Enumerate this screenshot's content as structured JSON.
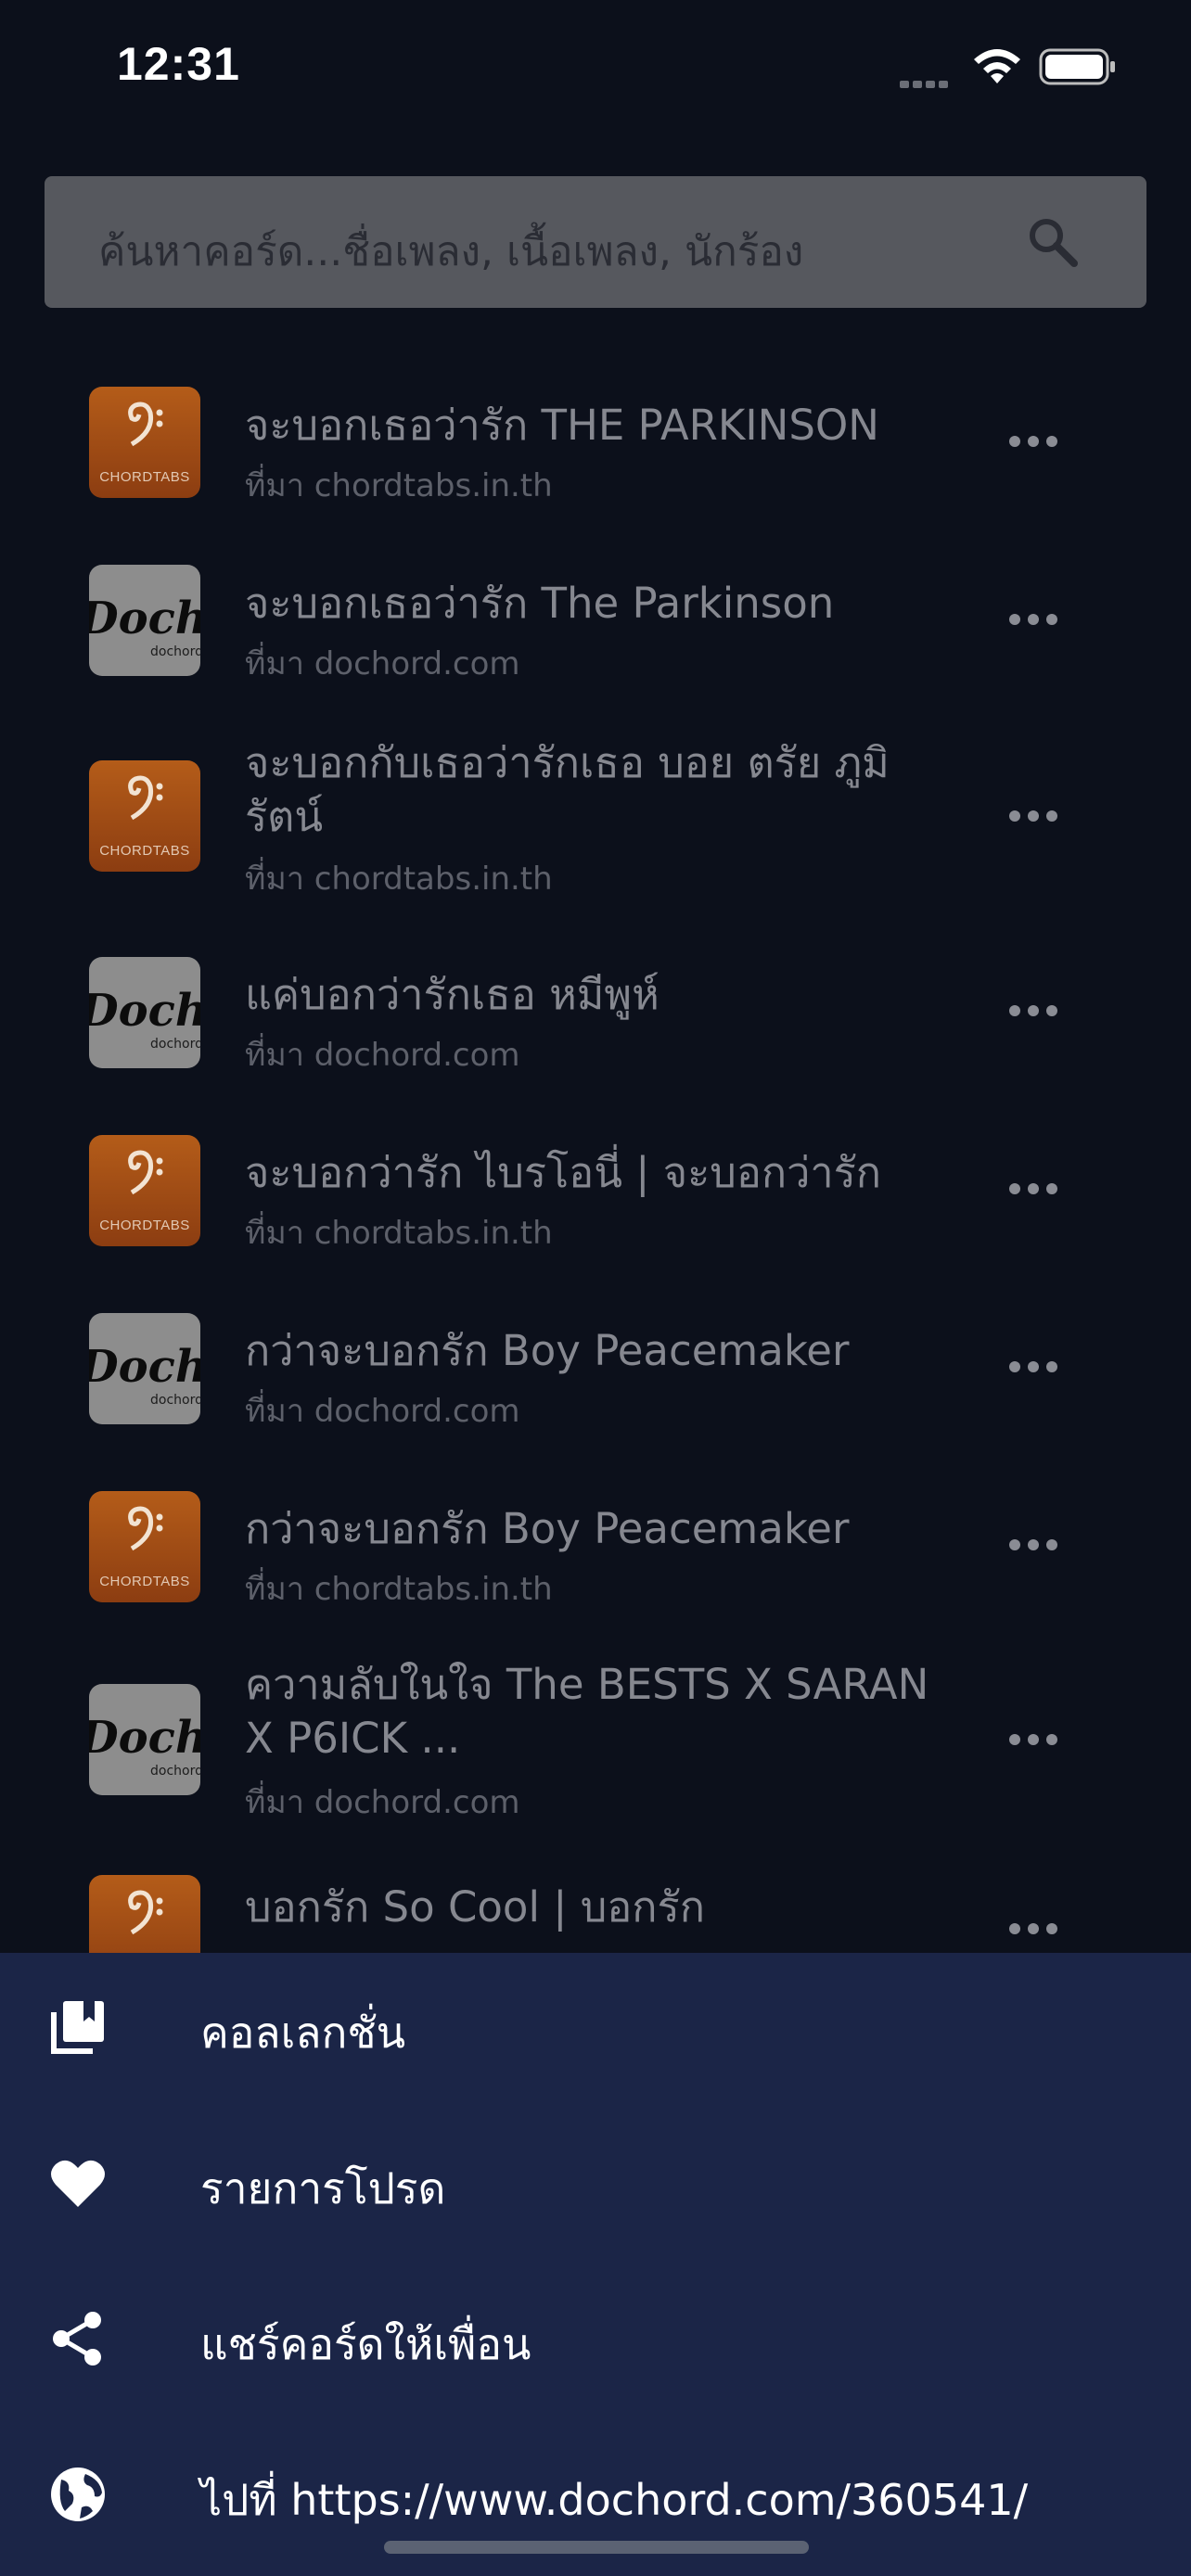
{
  "status_bar": {
    "time": "12:31"
  },
  "search": {
    "placeholder": "ค้นหาคอร์ด...ชื่อเพลง, เนื้อเพลง, นักร้อง"
  },
  "results": [
    {
      "title": "จะบอกเธอว่ารัก THE PARKINSON",
      "source": "ที่มา chordtabs.in.th",
      "logo": "chordtabs-logo"
    },
    {
      "title": "จะบอกเธอว่ารัก The Parkinson",
      "source": "ที่มา dochord.com",
      "logo": "dochord-logo"
    },
    {
      "title": "จะบอกกับเธอว่ารักเธอ บอย ตรัย ภูมิรัตน์",
      "source": "ที่มา chordtabs.in.th",
      "logo": "chordtabs-logo"
    },
    {
      "title": "แค่บอกว่ารักเธอ หมีพูห์",
      "source": "ที่มา dochord.com",
      "logo": "dochord-logo"
    },
    {
      "title": "จะบอกว่ารัก ไบรโอนี่ | จะบอกว่ารัก",
      "source": "ที่มา chordtabs.in.th",
      "logo": "chordtabs-logo"
    },
    {
      "title": "กว่าจะบอกรัก Boy Peacemaker",
      "source": "ที่มา dochord.com",
      "logo": "dochord-logo"
    },
    {
      "title": "กว่าจะบอกรัก Boy Peacemaker",
      "source": "ที่มา chordtabs.in.th",
      "logo": "chordtabs-logo"
    },
    {
      "title": "ความลับในใจ The BESTS X SARAN X P6ICK ...",
      "source": "ที่มา dochord.com",
      "logo": "dochord-logo"
    },
    {
      "title": "บอกรัก So Cool | บอกรัก",
      "source": "",
      "logo": "chordtabs-logo"
    }
  ],
  "logo_text": {
    "chordtabs": "CHORDTABS",
    "dochord": "Dochord",
    "dochord_sub": "dochord"
  },
  "sheet": {
    "items": [
      {
        "label": "คอลเลกชั่น",
        "icon": "collection-icon"
      },
      {
        "label": "รายการโปรด",
        "icon": "heart-icon"
      },
      {
        "label": "แชร์คอร์ดให้เพื่อน",
        "icon": "share-icon"
      },
      {
        "label": "ไปที่ https://www.dochord.com/360541/",
        "icon": "globe-icon"
      }
    ]
  },
  "colors": {
    "background": "#0c101b",
    "sheet": "#1b2547",
    "search": "#56585e",
    "chordtabs": "#b45c19"
  }
}
